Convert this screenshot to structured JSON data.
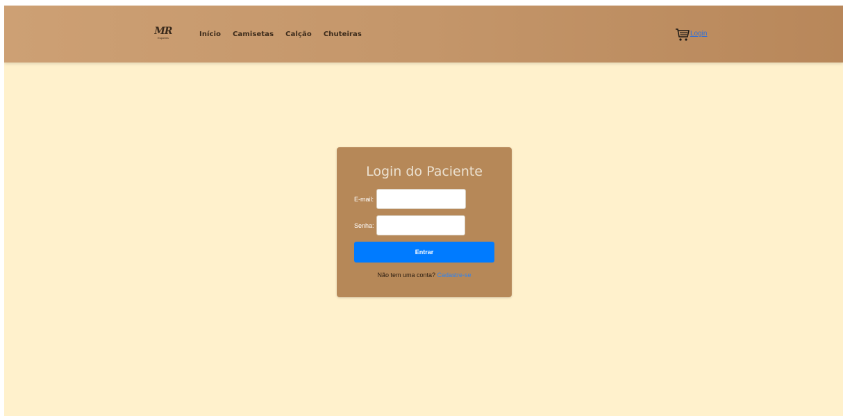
{
  "header": {
    "logo_text": "MR",
    "logo_subtext": "Esportes",
    "nav": [
      {
        "label": "Início"
      },
      {
        "label": "Camisetas"
      },
      {
        "label": "Calção"
      },
      {
        "label": "Chuteiras"
      }
    ],
    "cart_icon": "shopping-cart-icon",
    "login_label": "Login"
  },
  "login_form": {
    "title": "Login do Paciente",
    "email_label": "E-mail:",
    "email_value": "",
    "password_label": "Senha:",
    "password_value": "",
    "submit_label": "Entrar",
    "signup_prompt": "Não tem uma conta?",
    "signup_link": "Cadastre-se"
  },
  "colors": {
    "page_background": "#fff1cc",
    "header_background": "#c4966a",
    "card_background": "#b68858",
    "button_primary": "#007bff",
    "link": "#2f83f0"
  }
}
